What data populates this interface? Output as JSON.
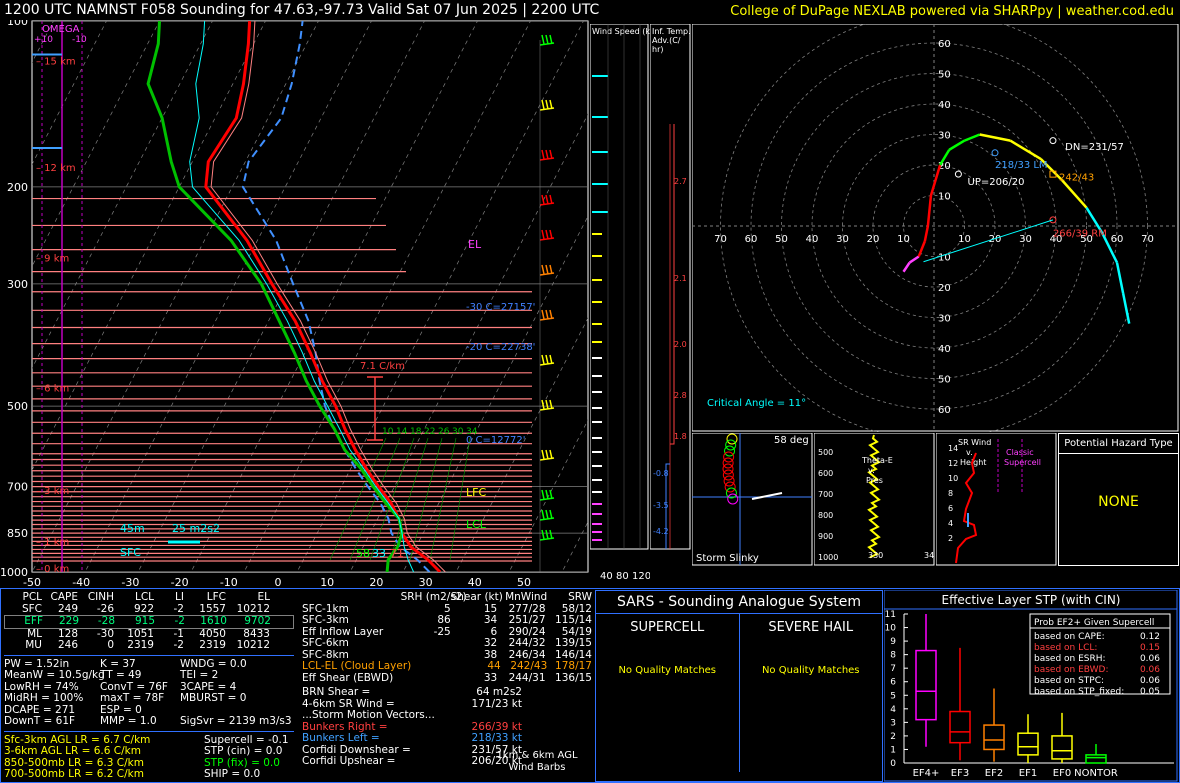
{
  "header": {
    "title": "1200 UTC NAMNST F058 Sounding for 47.63,-97.73 Valid  Sat 07 Jun 2025 | 2200 UTC",
    "credit": "College of DuPage NEXLAB powered via SHARPpy | weather.cod.edu"
  },
  "colors": {
    "temp": "#ff0000",
    "dewpoint": "#00c000",
    "virtual_temp": "#ff8080",
    "wetbulb": "#00ffff",
    "parcel": "#ffffff",
    "accent": "#ffff00"
  },
  "skewt": {
    "type": "line",
    "pressure_ticks": [
      100,
      200,
      300,
      500,
      700,
      850,
      1000
    ],
    "temp_ticks": [
      "-50",
      "-40",
      "-30",
      "-20",
      "-10",
      "0",
      "10",
      "20",
      "30",
      "40",
      "50"
    ],
    "height_labels": [
      "15 km",
      "12 km",
      "9 km",
      "6 km",
      "3 km",
      "1 km",
      "0 km"
    ],
    "omega_label": "OMEGA",
    "omega_ticks": [
      "+10",
      "-10"
    ],
    "temperature": [
      [
        1000,
        27
      ],
      [
        950,
        23.5
      ],
      [
        900,
        19
      ],
      [
        850,
        16
      ],
      [
        800,
        14
      ],
      [
        750,
        11
      ],
      [
        700,
        7
      ],
      [
        650,
        3
      ],
      [
        600,
        -1
      ],
      [
        550,
        -5
      ],
      [
        500,
        -9
      ],
      [
        450,
        -14
      ],
      [
        400,
        -19
      ],
      [
        350,
        -25
      ],
      [
        300,
        -33
      ],
      [
        250,
        -42
      ],
      [
        200,
        -55
      ],
      [
        180,
        -57
      ],
      [
        150,
        -56
      ],
      [
        130,
        -58
      ],
      [
        110,
        -61
      ],
      [
        100,
        -63
      ]
    ],
    "dewpoint": [
      [
        1000,
        17
      ],
      [
        950,
        16
      ],
      [
        900,
        16.5
      ],
      [
        850,
        16
      ],
      [
        800,
        14
      ],
      [
        750,
        10
      ],
      [
        700,
        6
      ],
      [
        650,
        2
      ],
      [
        600,
        -3
      ],
      [
        550,
        -7
      ],
      [
        500,
        -12
      ],
      [
        450,
        -17
      ],
      [
        400,
        -22
      ],
      [
        350,
        -28
      ],
      [
        300,
        -35
      ],
      [
        250,
        -45
      ],
      [
        200,
        -60
      ],
      [
        180,
        -64
      ],
      [
        150,
        -70
      ],
      [
        130,
        -76
      ],
      [
        110,
        -78
      ],
      [
        100,
        -80
      ]
    ],
    "annotations": {
      "lapse": "7.1 C/km",
      "el": "EL",
      "lfc": "LFC",
      "lcl": "LCL",
      "c30": "-30 C=27157'",
      "c20": "-20 C=22738'",
      "c0": "0 C=12772'",
      "sfc": "SFC",
      "sfc_t": "71",
      "sfc_td": "58",
      "sfc_tw": "33",
      "m2s2": "25 m2s2",
      "eff_depth": "45m",
      "wb_ticks": [
        "10",
        "14",
        "18",
        "22",
        "26",
        "30",
        "34"
      ]
    }
  },
  "wind_speed": {
    "label": "Wind Speed (knots)",
    "ticks": [
      "40",
      "80",
      "120"
    ]
  },
  "inf_temp": {
    "label": "Inf. Temp. Adv.(C/hr)",
    "values": [
      "2.7",
      "2.1",
      "2.0",
      "2.8",
      "1.8",
      "-0.8",
      "-3.5",
      "-4.2"
    ]
  },
  "hodograph": {
    "rings": [
      "10",
      "20",
      "30",
      "40",
      "50",
      "60",
      "70"
    ],
    "critical_angle": "Critical Angle = 11°",
    "labels": {
      "dn": "DN=231/57",
      "lm": "218/33 LM",
      "up": "UP=206/20",
      "mean": "242/43",
      "rm": "266/39 RM"
    },
    "points": [
      [
        -10,
        -15
      ],
      [
        -8,
        -12
      ],
      [
        -5,
        -10
      ],
      [
        -3,
        -5
      ],
      [
        -2,
        0
      ],
      [
        -1,
        10
      ],
      [
        2,
        20
      ],
      [
        5,
        25
      ],
      [
        10,
        28
      ],
      [
        15,
        30
      ],
      [
        25,
        28
      ],
      [
        35,
        22
      ],
      [
        42,
        15
      ],
      [
        50,
        6
      ],
      [
        55,
        -2
      ],
      [
        60,
        -12
      ],
      [
        62,
        -22
      ],
      [
        64,
        -32
      ]
    ]
  },
  "storm_slinky": {
    "label": "Storm Slinky",
    "angle": "58 deg"
  },
  "theta_e": {
    "label": "Theta-E v. Pres",
    "ticks": [
      "500",
      "600",
      "700",
      "800",
      "900",
      "1000"
    ],
    "xticks": [
      "330",
      "34"
    ]
  },
  "sr_wind": {
    "label": "SR Wind v. Height",
    "ticks": [
      "14",
      "12",
      "10",
      "8",
      "6",
      "4",
      "2"
    ],
    "class": "Classic Supercell"
  },
  "hazard": {
    "title": "Potential Hazard Type",
    "value": "NONE"
  },
  "thermo": {
    "headers": [
      "PCL",
      "CAPE",
      "CINH",
      "LCL",
      "LI",
      "LFC",
      "EL"
    ],
    "rows": [
      [
        "SFC",
        "249",
        "-26",
        "922",
        "-2",
        "1557",
        "10212"
      ],
      [
        "EFF",
        "229",
        "-28",
        "915",
        "-2",
        "1610",
        "9702"
      ],
      [
        "ML",
        "128",
        "-30",
        "1051",
        "-1",
        "4050",
        "8433"
      ],
      [
        "MU",
        "246",
        "0",
        "2319",
        "-2",
        "2319",
        "10212"
      ]
    ],
    "indices": [
      [
        "PW = 1.52in",
        "K = 37",
        "WNDG = 0.0"
      ],
      [
        "MeanW = 10.5g/kg",
        "TT = 49",
        "TEI = 2"
      ],
      [
        "LowRH = 74%",
        "ConvT = 76F",
        "3CAPE = 4"
      ],
      [
        "MidRH = 100%",
        "maxT = 78F",
        "MBURST = 0"
      ],
      [
        "DCAPE = 271",
        "ESP = 0",
        ""
      ],
      [
        "DownT = 61F",
        "MMP = 1.0",
        "SigSvr = 2139 m3/s3"
      ]
    ],
    "lapse": [
      "Sfc-3km AGL LR = 6.7 C/km",
      "3-6km AGL LR = 6.6 C/km",
      "850-500mb LR = 6.3 C/km",
      "700-500mb LR = 6.2 C/km"
    ],
    "composite": [
      "Supercell = -0.1",
      "STP (cin) = 0.0",
      "STP (fix) = 0.0",
      "SHIP = 0.0"
    ]
  },
  "kinematic": {
    "headers": [
      "",
      "SRH (m2/s2)",
      "Shear (kt)",
      "MnWind",
      "SRW"
    ],
    "rows": [
      [
        "SFC-1km",
        "5",
        "15",
        "277/28",
        "58/12"
      ],
      [
        "SFC-3km",
        "86",
        "34",
        "251/27",
        "115/14"
      ],
      [
        "Eff Inflow Layer",
        "-25",
        "6",
        "290/24",
        "54/19"
      ],
      [
        "",
        "",
        "",
        "",
        ""
      ],
      [
        "SFC-6km",
        "",
        "32",
        "244/32",
        "139/15"
      ],
      [
        "SFC-8km",
        "",
        "38",
        "246/34",
        "146/14"
      ],
      [
        "LCL-EL (Cloud Layer)",
        "",
        "44",
        "242/43",
        "178/17"
      ],
      [
        "Eff Shear (EBWD)",
        "",
        "33",
        "244/31",
        "136/15"
      ]
    ],
    "brn": [
      "BRN Shear =",
      "64 m2s2"
    ],
    "srwind": [
      "4-6km SR Wind =",
      "171/23 kt"
    ],
    "motion_title": "...Storm Motion Vectors...",
    "motion": [
      [
        "Bunkers Right =",
        "266/39 kt"
      ],
      [
        "Bunkers Left =",
        "218/33 kt"
      ],
      [
        "Corfidi Downshear =",
        "231/57 kt"
      ],
      [
        "Corfidi Upshear =",
        "206/20 kt"
      ]
    ],
    "barbs_label": "1km & 6km AGL Wind Barbs"
  },
  "sars": {
    "title": "SARS - Sounding Analogue System",
    "supercell": "SUPERCELL",
    "hail": "SEVERE HAIL",
    "sc_result": "No Quality Matches",
    "hail_result": "No Quality Matches"
  },
  "stp": {
    "title": "Effective Layer STP (with CIN)",
    "type": "box",
    "categories": [
      "EF4+",
      "EF3",
      "EF2",
      "EF1",
      "EF0",
      "NONTOR"
    ],
    "boxes": [
      [
        1.2,
        3.2,
        5.3,
        8.3,
        11
      ],
      [
        0.2,
        1.5,
        2.3,
        3.8,
        8.5
      ],
      [
        0.1,
        1,
        1.7,
        2.8,
        5.5
      ],
      [
        0,
        0.6,
        1.2,
        2.2,
        3.6
      ],
      [
        0,
        0.3,
        0.9,
        2,
        3.7
      ],
      [
        0,
        0,
        0.4,
        0.6,
        1.4
      ]
    ],
    "ylim": [
      0,
      11
    ],
    "box_title": "Prob EF2+ Given Supercell",
    "probs": [
      [
        "based on CAPE:",
        "0.12"
      ],
      [
        "based on LCL:",
        "0.15"
      ],
      [
        "based on ESRH:",
        "0.06"
      ],
      [
        "based on EBWD:",
        "0.06"
      ],
      [
        "based on STPC:",
        "0.06"
      ],
      [
        "based on STP_fixed:",
        "0.05"
      ]
    ]
  }
}
